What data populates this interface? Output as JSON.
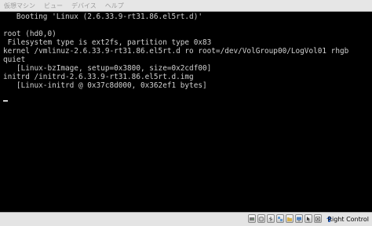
{
  "menu": {
    "items": [
      "仮想マシン",
      "ビュー",
      "デバイス",
      "ヘルプ"
    ]
  },
  "console": {
    "lines": [
      "   Booting 'Linux (2.6.33.9-rt31.86.el5rt.d)'",
      "",
      "root (hd0,0)",
      " Filesystem type is ext2fs, partition type 0x83",
      "kernel /vmlinuz-2.6.33.9-rt31.86.el5rt.d ro root=/dev/VolGroup00/LogVol01 rhgb",
      "quiet",
      "   [Linux-bzImage, setup=0x3800, size=0x2cdf00]",
      "initrd /initrd-2.6.33.9-rt31.86.el5rt.d.img",
      "   [Linux-initrd @ 0x37c8d000, 0x362ef1 bytes]"
    ]
  },
  "statusbar": {
    "host_key": "Right Control",
    "icons": [
      "hard-disk-icon",
      "cd-icon",
      "usb-icon",
      "network-icon",
      "shared-folder-icon",
      "display-icon",
      "mouse-integration-icon",
      "virtualization-icon"
    ]
  },
  "colors": {
    "console_bg": "#000000",
    "console_text": "#d0d0d0",
    "menubar_bg": "#e6e6e6"
  }
}
